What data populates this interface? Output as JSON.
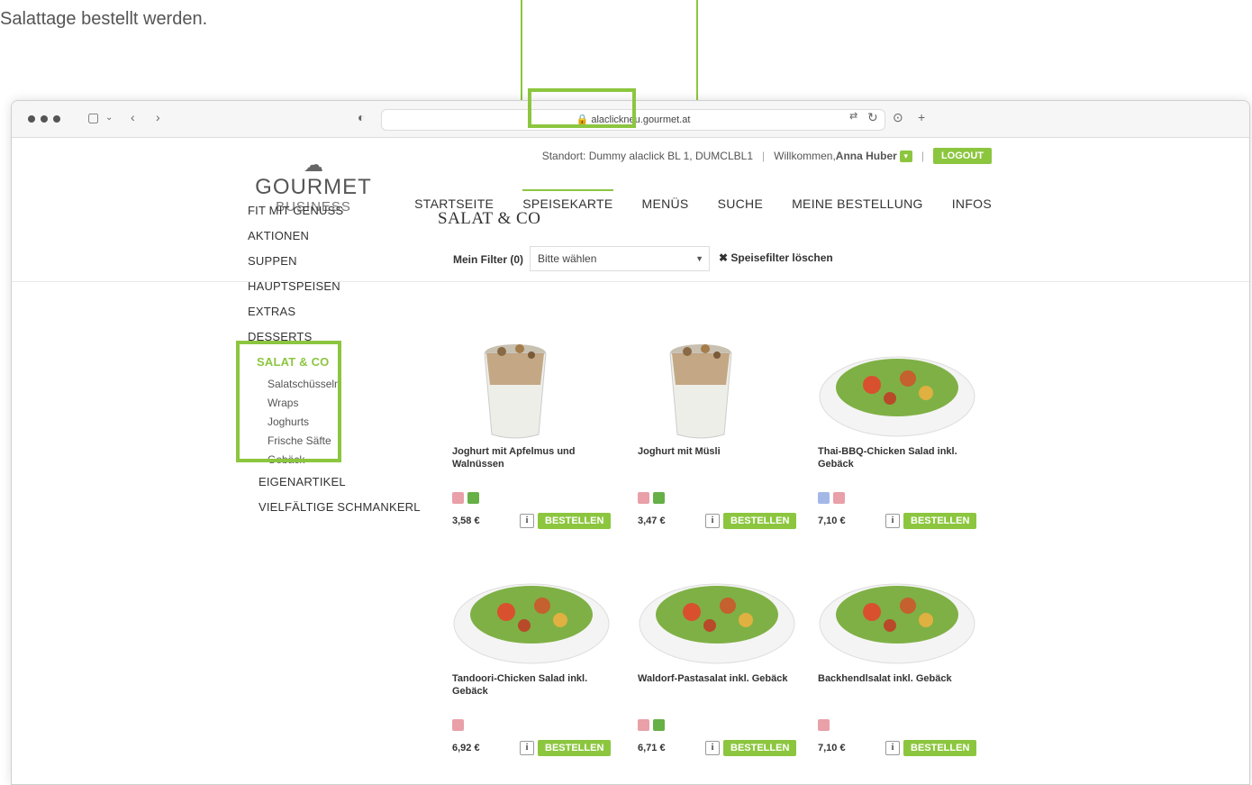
{
  "caption": "Salattage bestellt werden.",
  "browser": {
    "url": "alaclickneu.gourmet.at"
  },
  "header": {
    "logo": {
      "brand": "GOURMET",
      "sub": "BUSINESS"
    },
    "standort": "Standort: Dummy alaclick BL 1, DUMCLBL1",
    "welcome_prefix": "Willkommen, ",
    "user_name": "Anna Huber",
    "logout_label": "LOGOUT",
    "nav": [
      "STARTSEITE",
      "SPEISEKARTE",
      "MENÜS",
      "SUCHE",
      "MEINE BESTELLUNG",
      "INFOS"
    ],
    "active_nav": "SPEISEKARTE"
  },
  "filter": {
    "label": "Mein Filter (0)",
    "select_value": "Bitte wählen",
    "clear_label": "Speisefilter löschen"
  },
  "sidebar": {
    "categories_before": [
      "FIT MIT GENUSS",
      "AKTIONEN",
      "SUPPEN",
      "HAUPTSPEISEN",
      "EXTRAS",
      "DESSERTS"
    ],
    "active_category": "SALAT & CO",
    "subcategories": [
      "Salatschüsseln",
      "Wraps",
      "Joghurts",
      "Frische Säfte",
      "Gebäck"
    ],
    "categories_after": [
      "EIGENARTIKEL",
      "VIELFÄLTIGE SCHMANKERL"
    ]
  },
  "content": {
    "heading": "SALAT & CO",
    "order_label": "BESTELLEN",
    "info_label": "i",
    "products": [
      {
        "title": "Joghurt mit Apfelmus und Walnüssen",
        "price": "3,58 €",
        "tags": [
          "meat",
          "veg"
        ],
        "image": "yogurt-cup"
      },
      {
        "title": "Joghurt mit Müsli",
        "price": "3,47 €",
        "tags": [
          "meat",
          "veg"
        ],
        "image": "yogurt-cup"
      },
      {
        "title": "Thai-BBQ-Chicken Salad inkl. Gebäck",
        "price": "7,10 €",
        "tags": [
          "fish",
          "meat"
        ],
        "image": "salad-bowl"
      },
      {
        "title": "Tandoori-Chicken Salad inkl. Gebäck",
        "price": "6,92 €",
        "tags": [
          "meat"
        ],
        "image": "salad-bowl"
      },
      {
        "title": "Waldorf-Pastasalat inkl. Gebäck",
        "price": "6,71 €",
        "tags": [
          "meat",
          "veg"
        ],
        "image": "salad-bowl"
      },
      {
        "title": "Backhendlsalat inkl. Gebäck",
        "price": "7,10 €",
        "tags": [
          "meat"
        ],
        "image": "salad-bowl"
      }
    ]
  },
  "colors": {
    "accent": "#8cc63f"
  }
}
